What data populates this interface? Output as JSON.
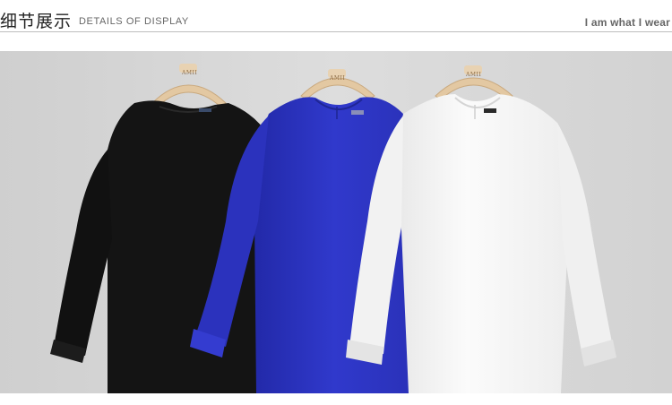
{
  "header": {
    "title_cn": "细节展示",
    "title_en": "DETAILS OF DISPLAY",
    "slogan": "I am what I wear"
  },
  "photo": {
    "hangers": [
      {
        "brand": "AMII"
      },
      {
        "brand": "AMII"
      },
      {
        "brand": "AMII"
      }
    ],
    "colors": {
      "background": "#d7d7d7",
      "black_garment": "#141414",
      "blue_garment": "#2f36c8",
      "white_garment": "#f6f6f6",
      "hanger_wood": "#e3c8a2"
    }
  }
}
